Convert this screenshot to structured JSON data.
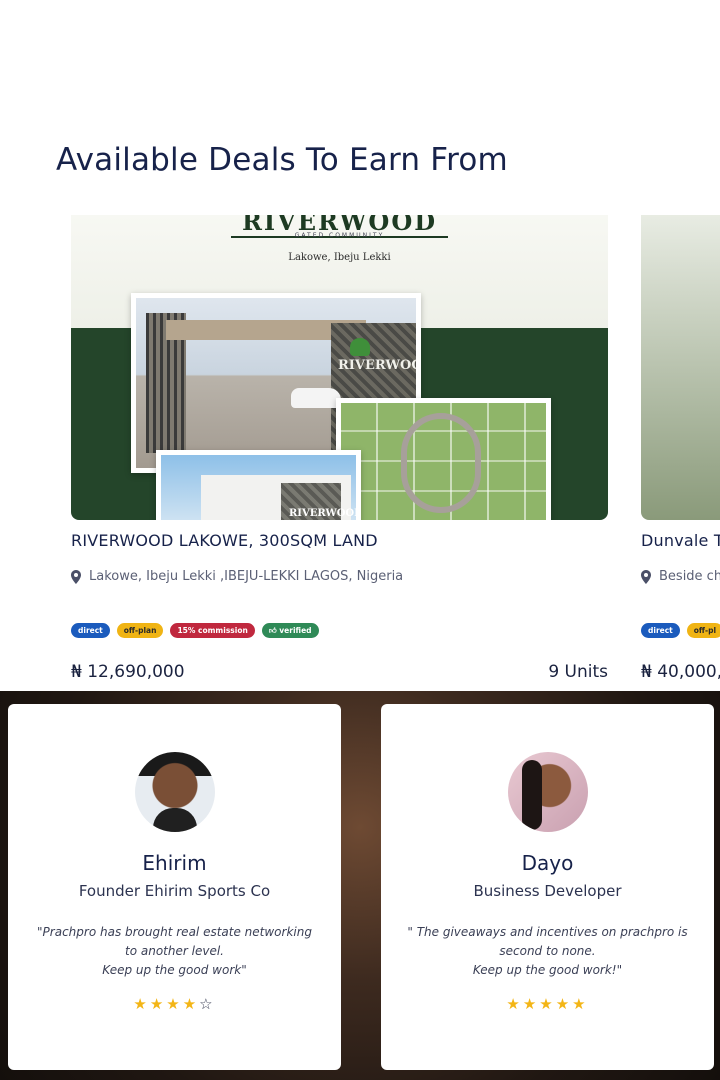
{
  "section": {
    "title": "Available Deals To Earn From"
  },
  "deals": [
    {
      "image": {
        "brand": "RIVERWOOD",
        "brand_subtitle": "GATED COMMUNITY",
        "location": "Lakowe, Ibeju Lekki",
        "sign_text": "RIVERWOOD"
      },
      "name": "RIVERWOOD LAKOWE, 300SQM LAND",
      "location": "Lakowe, Ibeju Lekki ,IBEJU-LEKKI LAGOS, Nigeria",
      "badges": [
        "direct",
        "off-plan",
        "15% commission",
        "verified"
      ],
      "price": "₦ 12,690,000",
      "units": "9 Units"
    },
    {
      "name": "Dunvale T",
      "location": "Beside ch",
      "badges": [
        "direct",
        "off-pl"
      ],
      "price": "₦ 40,000,"
    }
  ],
  "testimonials": [
    {
      "name": "Ehirim",
      "role": "Founder Ehirim Sports Co",
      "quote_lines": [
        "\"Prachpro has brought real estate networking",
        "to another level.",
        "Keep up the good work\""
      ],
      "rating": 4
    },
    {
      "name": "Dayo",
      "role": "Business Developer",
      "quote_lines": [
        "\" The giveaways and incentives on prachpro is",
        "second to none.",
        "Keep up the good work!\""
      ],
      "rating": 5
    }
  ],
  "icons": {
    "location": "map-pin-icon",
    "verified": "thumbs-up-icon",
    "star": "star-icon"
  },
  "colors": {
    "heading": "#17224a",
    "direct": "#1b5bbd",
    "off_plan": "#f0b414",
    "commission": "#c0283e",
    "verified": "#2f8a57",
    "star": "#f3b516"
  }
}
